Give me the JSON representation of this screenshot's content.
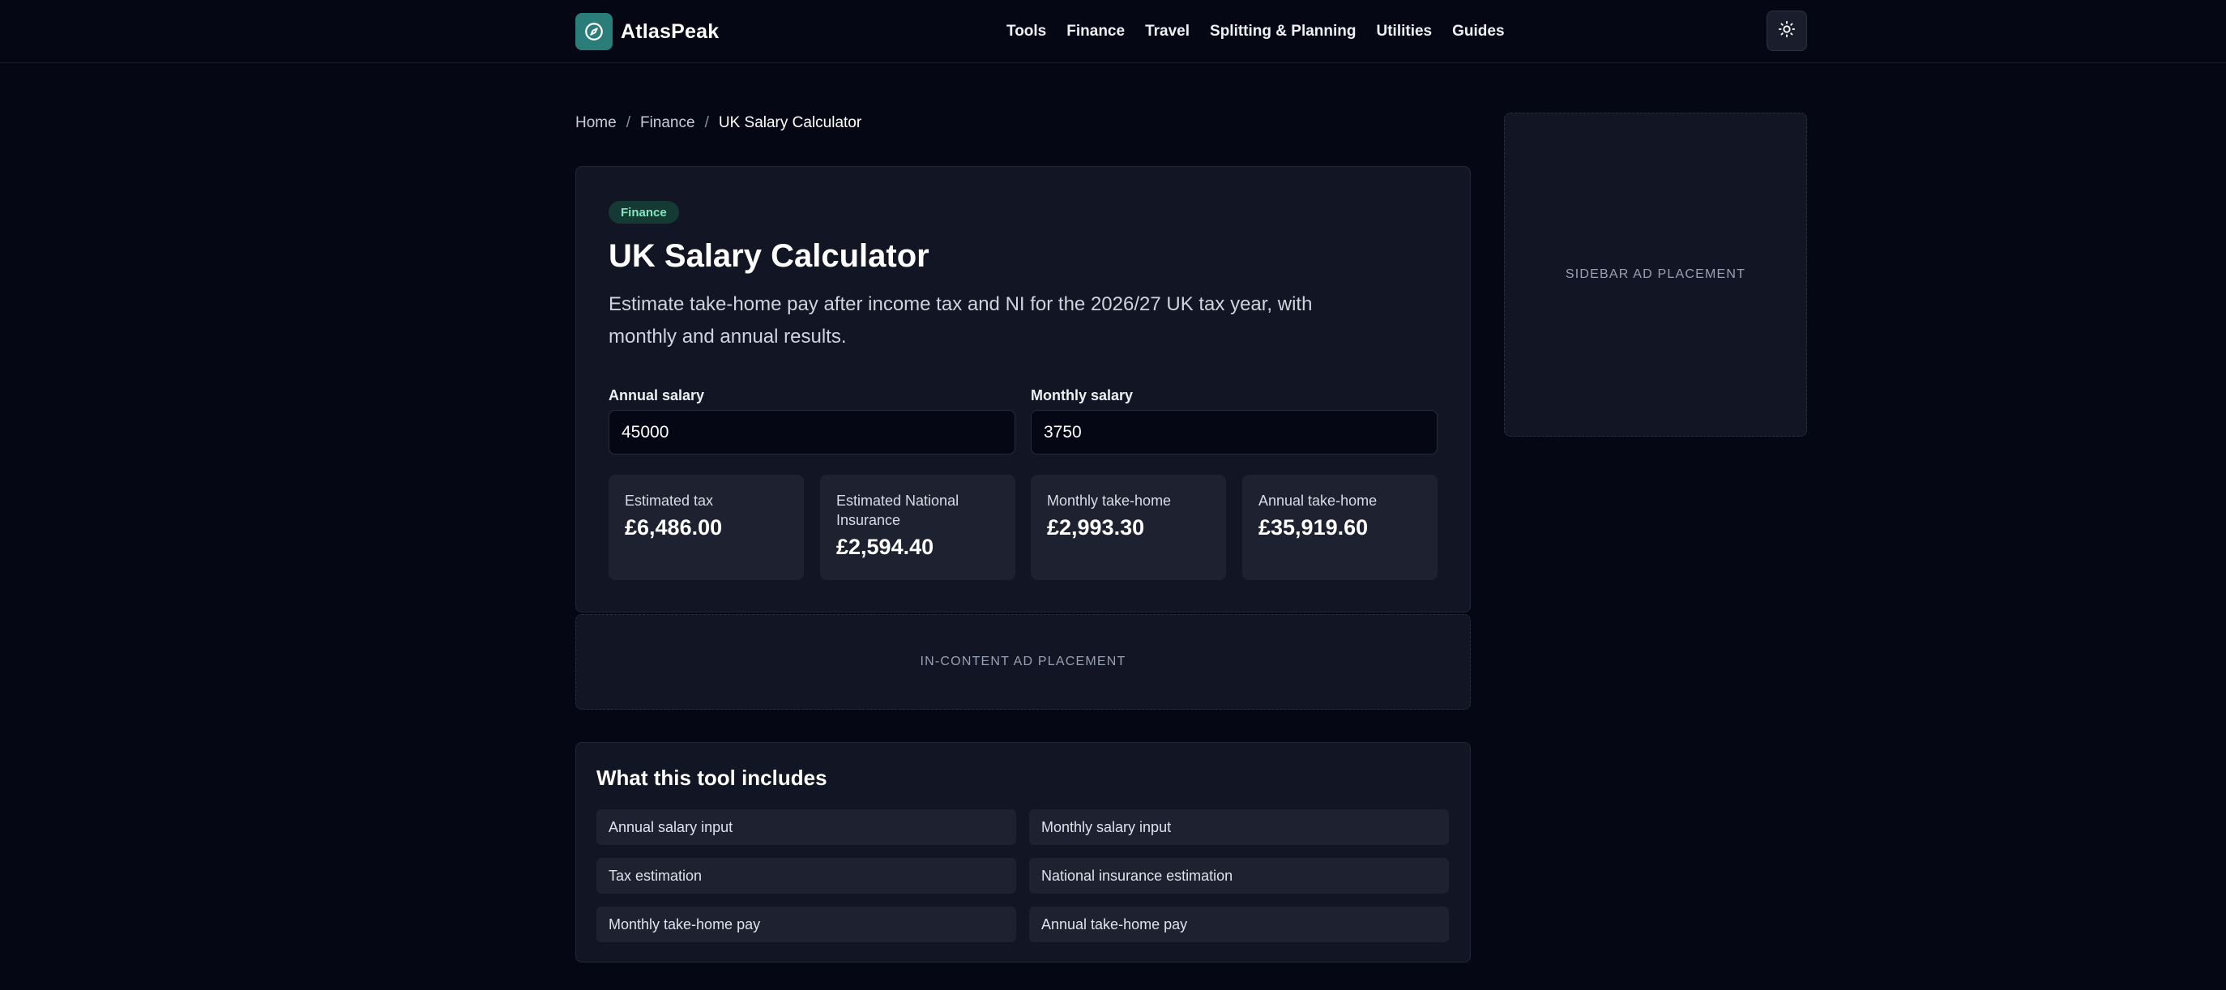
{
  "header": {
    "logo_text": "AtlasPeak",
    "nav": [
      "Tools",
      "Finance",
      "Travel",
      "Splitting & Planning",
      "Utilities",
      "Guides"
    ]
  },
  "breadcrumb": {
    "home": "Home",
    "section": "Finance",
    "current": "UK Salary Calculator"
  },
  "tool": {
    "badge": "Finance",
    "title": "UK Salary Calculator",
    "description": "Estimate take-home pay after income tax and NI for the 2026/27 UK tax year, with monthly and annual results.",
    "annual_label": "Annual salary",
    "annual_value": "45000",
    "monthly_label": "Monthly salary",
    "monthly_value": "3750",
    "results": [
      {
        "label": "Estimated tax",
        "value": "£6,486.00"
      },
      {
        "label": "Estimated National Insurance",
        "value": "£2,594.40"
      },
      {
        "label": "Monthly take-home",
        "value": "£2,993.30"
      },
      {
        "label": "Annual take-home",
        "value": "£35,919.60"
      }
    ]
  },
  "ads": {
    "in_content": "IN-CONTENT AD PLACEMENT",
    "sidebar": "SIDEBAR AD PLACEMENT"
  },
  "includes": {
    "title": "What this tool includes",
    "items": [
      "Annual salary input",
      "Monthly salary input",
      "Tax estimation",
      "National insurance estimation",
      "Monthly take-home pay",
      "Annual take-home pay"
    ]
  },
  "colors": {
    "background": "#050814",
    "card": "#121624",
    "accent": "#2a7d78",
    "badge_text": "#86e3c1"
  },
  "icons": {
    "logo": "compass-icon",
    "theme_toggle": "sun-icon"
  }
}
